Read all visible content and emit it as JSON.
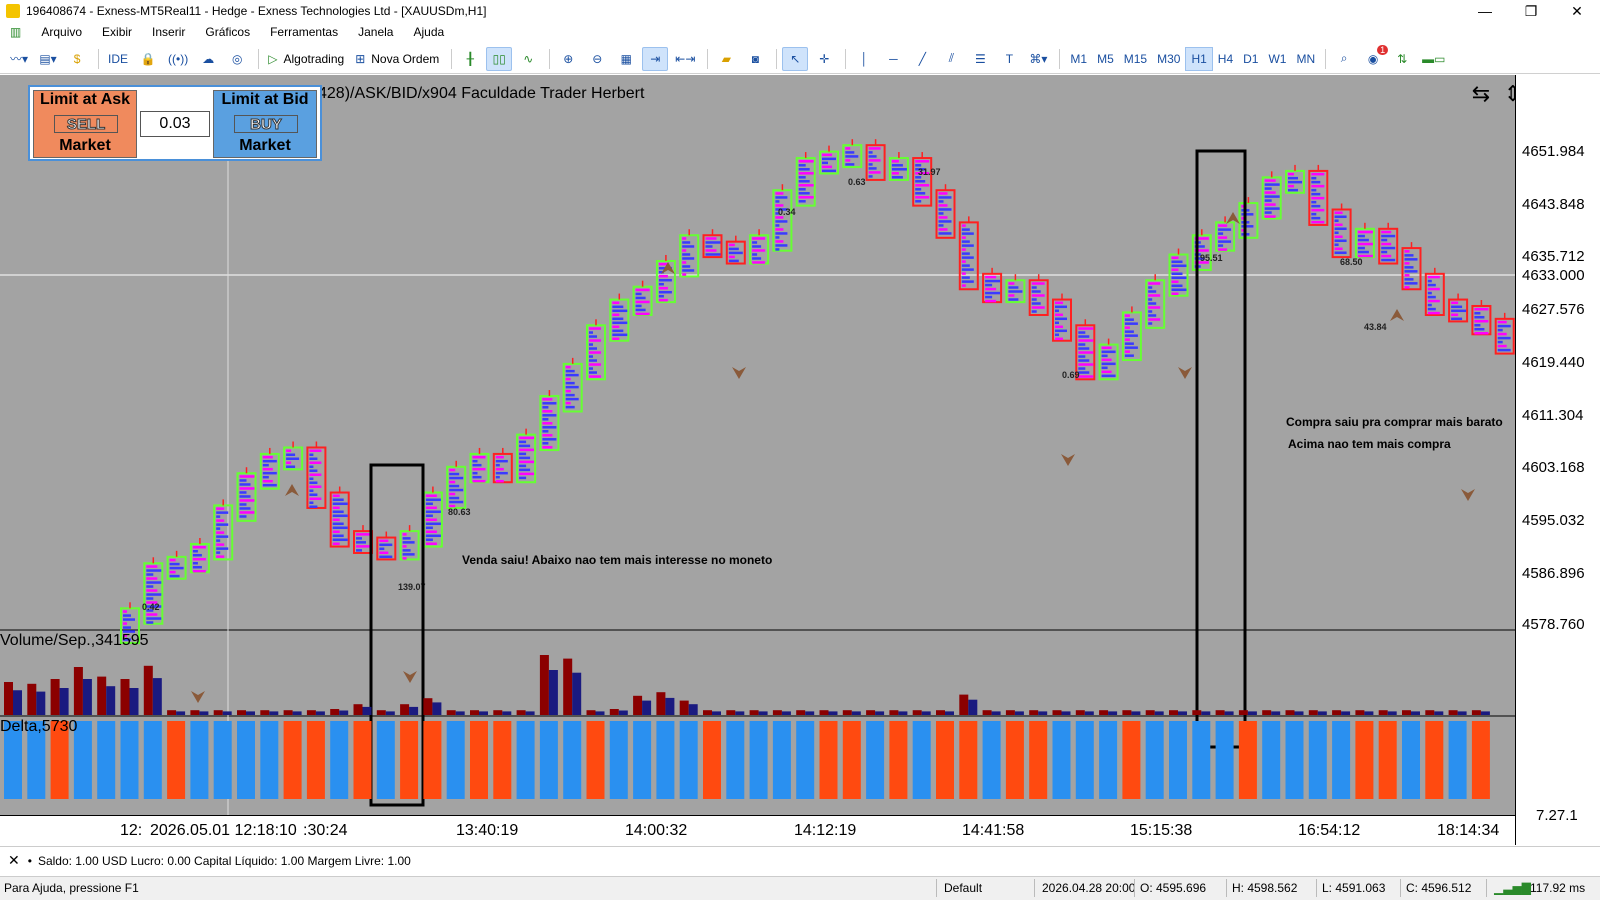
{
  "window": {
    "title": "196408674 - Exness-MT5Real11 - Hedge - Exness Technologies Ltd - [XAUUSDm,H1]",
    "minimize": "—",
    "maximize": "❐",
    "close": "✕"
  },
  "menu": [
    "Arquivo",
    "Exibir",
    "Inserir",
    "Gráficos",
    "Ferramentas",
    "Janela",
    "Ajuda"
  ],
  "toolbar": {
    "ide_label": "IDE",
    "algotrading_label": "Algotrading",
    "new_order_label": "Nova Ordem",
    "timeframes": [
      "M1",
      "M5",
      "M15",
      "M30",
      "H1",
      "H4",
      "D1",
      "W1",
      "MN"
    ],
    "active_timeframe": "H1",
    "notification_count": "1"
  },
  "trade_panel": {
    "sell_top": "Limit at Ask",
    "sell_mid": "SELL",
    "sell_bottom": "Market",
    "quantity": "0.03",
    "buy_top": "Limit at Bid",
    "buy_mid": "BUY",
    "buy_bottom": "Market"
  },
  "chart": {
    "caption": "428)/ASK/BID/x904   Faculdade Trader Herbert",
    "price_labels": [
      "4651.984",
      "4643.848",
      "4635.712",
      "4633.000",
      "4627.576",
      "4619.440",
      "4611.304",
      "4603.168",
      "4595.032",
      "4586.896",
      "4578.760"
    ],
    "time_labels": [
      "12:",
      "2026.05.01 12:18:10",
      ":30:24",
      "13:40:19",
      "14:00:32",
      "14:12:19",
      "14:41:58",
      "15:15:38",
      "16:54:12",
      "18:14:34"
    ],
    "axis_corner": "7.27.1",
    "volume_label": "Volume/Sep.,341595",
    "delta_label": "Delta,5730",
    "annotations": {
      "sell_note": "Venda saiu! Abaixo nao tem mais interesse no moneto",
      "buy_note_1": "Compra saiu pra comprar mais barato",
      "buy_note_2": "Acima nao tem mais compra"
    },
    "small_values": [
      "0.42",
      "139.07",
      "80.63",
      "0.34",
      "0.63",
      "31.97",
      "0.69",
      "95.51",
      "68.50",
      "43.84"
    ]
  },
  "chart_data": {
    "type": "bar",
    "title": "",
    "series_volume": [
      55,
      52,
      60,
      80,
      64,
      60,
      82,
      8,
      8,
      8,
      8,
      8,
      8,
      8,
      10,
      18,
      8,
      18,
      28,
      8,
      8,
      8,
      8,
      100,
      94,
      8,
      10,
      32,
      38,
      24,
      8,
      8,
      8,
      8,
      8,
      8,
      8,
      8,
      8,
      8,
      8,
      34,
      8,
      8,
      8,
      8,
      8,
      8,
      8,
      8,
      8,
      8,
      8,
      8,
      8,
      8,
      8,
      8,
      8,
      8,
      8,
      8,
      8,
      8,
      8,
      8,
      8,
      8,
      8,
      8,
      8,
      8
    ],
    "delta_sign": [
      "+",
      "+",
      "-",
      "+",
      "+",
      "+",
      "+",
      "-",
      "+",
      "+",
      "+",
      "+",
      "-",
      "-",
      "+",
      "-",
      "+",
      "-",
      "-",
      "+",
      "-",
      "-",
      "+"
    ],
    "ylim": [
      4578.76,
      4651.984
    ]
  },
  "status": {
    "balance": "Saldo: 1.00 USD  Lucro: 0.00  Capital Líquido: 1.00  Margem Livre: 1.00",
    "help": "Para Ajuda, pressione F1",
    "profile": "Default",
    "datetime": "2026.04.28 20:00",
    "open": "O: 4595.696",
    "high": "H: 4598.562",
    "low": "L: 4591.063",
    "close": "C: 4596.512",
    "ping": "117.92 ms"
  }
}
